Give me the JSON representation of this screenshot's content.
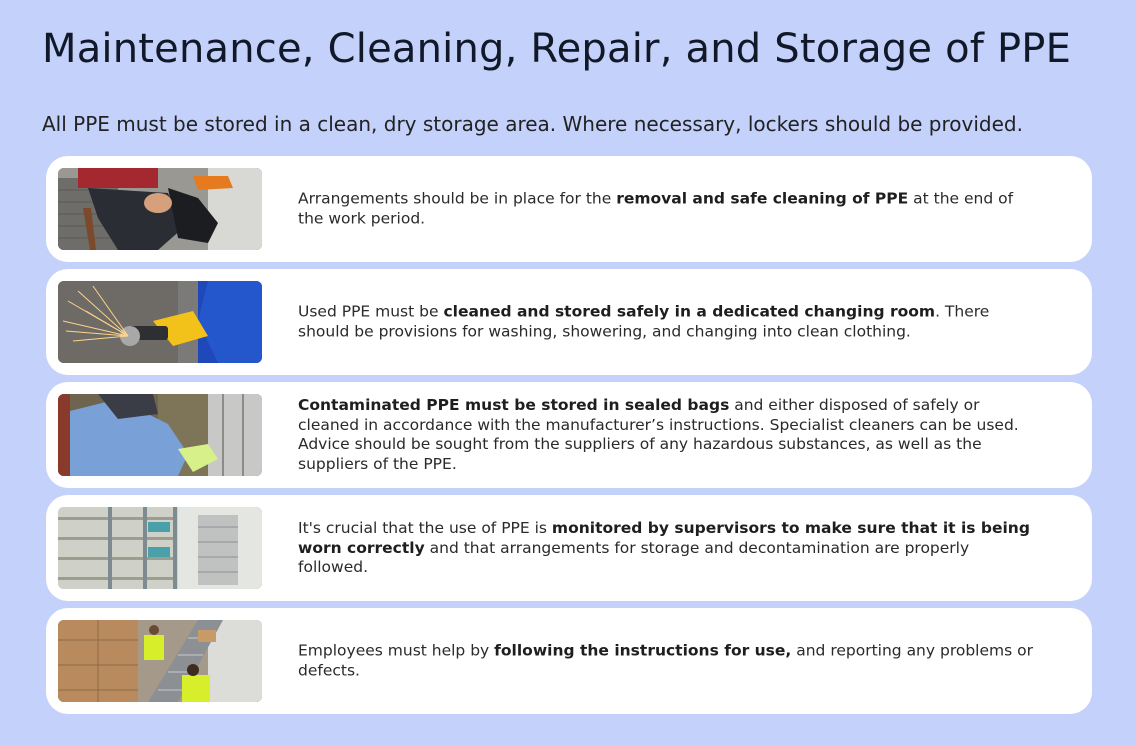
{
  "page": {
    "title": "Maintenance, Cleaning, Repair, and Storage of PPE",
    "intro": "All PPE must be stored in a clean, dry storage area. Where necessary, lockers should be provided."
  },
  "cards": [
    {
      "image_icon": "worker-putting-on-safety-boots-photo",
      "pre": "Arrangements should be in place for the ",
      "bold": "removal and safe cleaning of PPE",
      "post": " at the end of the work period."
    },
    {
      "image_icon": "angle-grinder-sparks-photo",
      "pre": "Used PPE must be ",
      "bold": "cleaned and stored safely in a dedicated changing room",
      "post": ". There should be provisions for washing, showering, and changing into clean clothing."
    },
    {
      "image_icon": "worker-in-protective-suit-photo",
      "pre": "",
      "bold": "Contaminated PPE must be stored in sealed bags",
      "post": " and either disposed of safely or cleaned in accordance with the manufacturer’s instructions. Specialist cleaners can be used. Advice should be sought from the suppliers of any hazardous substances, as well as the suppliers of the PPE."
    },
    {
      "image_icon": "storage-shelving-room-photo",
      "pre": "It's crucial that the use of PPE is ",
      "bold": "monitored by supervisors to make sure that it is being worn correctly",
      "post": " and that arrangements for storage and decontamination are properly followed."
    },
    {
      "image_icon": "warehouse-workers-conveyor-photo",
      "pre": "Employees must help by ",
      "bold": "following the instructions for use,",
      "post": " and reporting any problems or defects."
    }
  ],
  "colors": {
    "background": "#c3d1fb",
    "card": "#ffffff",
    "title": "#111827"
  }
}
